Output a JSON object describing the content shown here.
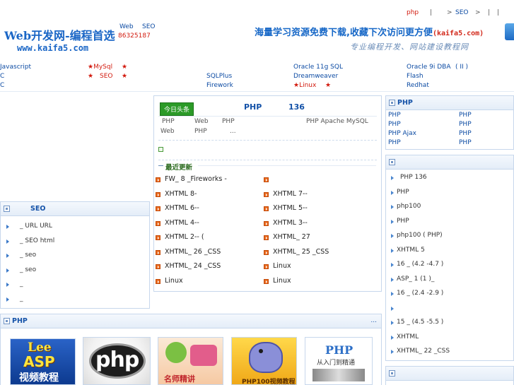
{
  "topbar": {
    "php": "php",
    "sep1": "|",
    "gt1": ">",
    "seo": "SEO",
    "gt2": ">",
    "sep2": "|",
    "sep3": "|"
  },
  "logo": {
    "title": "Web开发网-编程首选",
    "url": "www.kaifa5.com"
  },
  "header_info": {
    "web": "Web",
    "seo": "SEO",
    "phone": "86325187"
  },
  "banner": {
    "line1": "海量学习资源免费下载,收藏下次访问更方便",
    "line1_url": "(kaifa5.com)",
    "line2": "专业编程开发、网站建设教程网"
  },
  "nav": {
    "row1": [
      "Javascript",
      "★MySql",
      "★",
      "Oracle 11g SQL",
      "Oracle 9i DBA",
      "( II )"
    ],
    "row2": [
      "C",
      "★",
      "SEO",
      "★",
      "SQLPlus",
      "Dreamweaver",
      "Flash"
    ],
    "row3": [
      "C",
      "Firework",
      "★Linux",
      "★",
      "Redhat"
    ]
  },
  "center": {
    "badge": "今日头条",
    "headline_a": "PHP",
    "headline_b": "136",
    "sub1": [
      "PHP",
      "Web",
      "PHP",
      "PHP Apache MySQL"
    ],
    "sub2": [
      "Web",
      "PHP",
      "..."
    ],
    "recent_title": "最近更新",
    "left_items": [
      "FW_ 8 _Fireworks  -",
      "XHTML      8-",
      "XHTML      6--",
      "XHTML      4--",
      "XHTML      2--   (",
      "XHTML_ 26 _CSS",
      "XHTML_ 24 _CSS",
      "Linux"
    ],
    "right_items": [
      "",
      "XHTML      7--",
      "XHTML      5--",
      "XHTML      3--",
      "XHTML_ 27",
      "XHTML_ 25 _CSS",
      "Linux",
      "Linux"
    ]
  },
  "seo_panel": {
    "title": "SEO",
    "items": [
      "_      URL    URL",
      "_    SEO      html",
      "_      seo",
      "_       seo",
      "_",
      "_"
    ]
  },
  "php_cat": {
    "title": "PHP",
    "col1": [
      "PHP",
      "PHP",
      "PHP Ajax",
      "PHP"
    ],
    "col2": [
      "PHP",
      "PHP",
      "PHP",
      "PHP"
    ]
  },
  "right_list": {
    "items": [
      "PHP      136",
      "PHP",
      "php100",
      "    PHP",
      "php100    (    PHP)",
      "XHTML 5",
      "16 _      (4.2 -4.7  )",
      "ASP_ 1 (1  )_",
      "16 _      (2.4 -2.9  )",
      "",
      "15 _      (4.5 -5.5  )",
      "XHTML",
      "XHTML_ 22 _CSS"
    ]
  },
  "bottom_php": {
    "title": "PHP",
    "more": "...",
    "thumb_lee": "Lee",
    "thumb_asp": "ASP",
    "thumb_video": "视频教程",
    "thumb_php": "php",
    "thumb_famous": "名师精讲",
    "thumb_php100": "PHP100视频教程",
    "thumb_php_book": "PHP",
    "thumb_book_sub": "从入门到精通"
  }
}
